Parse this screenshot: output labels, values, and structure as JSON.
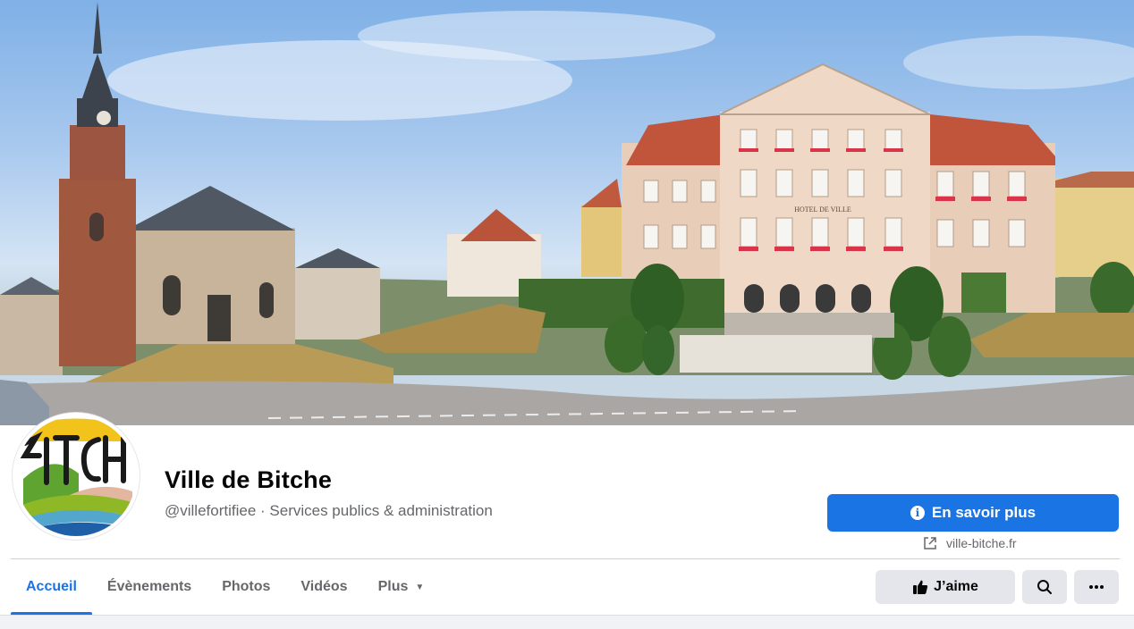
{
  "page": {
    "name": "Ville de Bitche",
    "handle_category": "@villefortifiee · Services publics & administration"
  },
  "cta": {
    "label": "En savoir plus",
    "icon": "info-circle-icon"
  },
  "website": {
    "url": "ville-bitche.fr",
    "icon": "external-link-icon"
  },
  "tabs": [
    {
      "label": "Accueil",
      "active": true
    },
    {
      "label": "Évènements",
      "active": false
    },
    {
      "label": "Photos",
      "active": false
    },
    {
      "label": "Vidéos",
      "active": false
    },
    {
      "label": "Plus",
      "active": false
    }
  ],
  "actions": {
    "like_label": "J’aime",
    "like_icon": "thumbs-up-icon",
    "search_icon": "search-icon",
    "more_icon": "more-dots-icon"
  },
  "cover": {
    "building_sign": "HOTEL DE VILLE"
  },
  "colors": {
    "accent": "#1b74e4",
    "secondary_text": "#65676b",
    "button_grey": "#e4e6eb"
  }
}
